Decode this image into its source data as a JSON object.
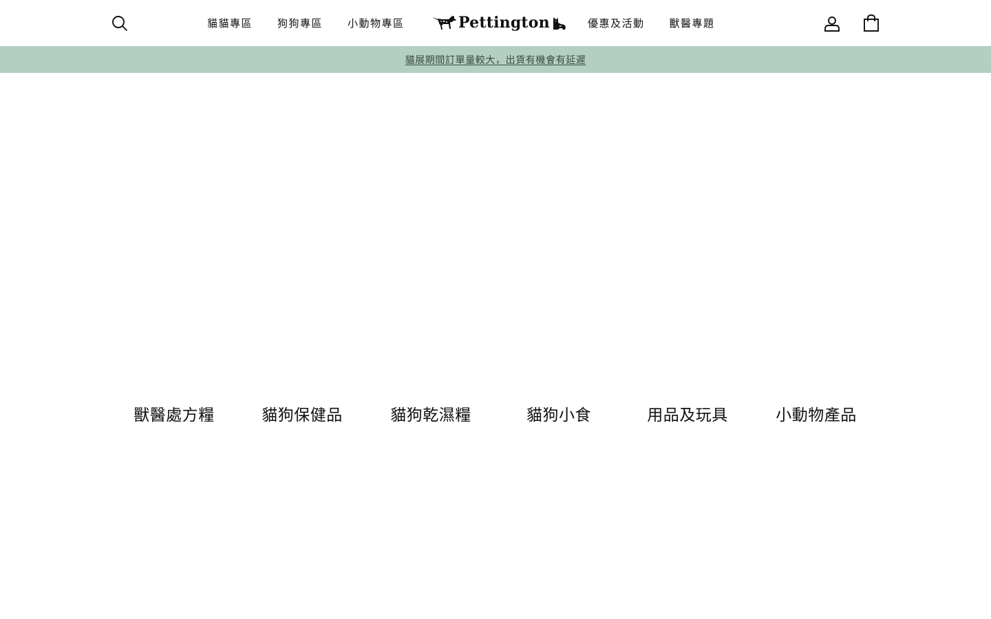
{
  "header": {
    "nav_left": [
      {
        "label": "貓貓專區"
      },
      {
        "label": "狗狗專區"
      },
      {
        "label": "小動物專區"
      }
    ],
    "logo_text": "Pettington",
    "nav_right": [
      {
        "label": "優惠及活動"
      },
      {
        "label": "獸醫專題"
      }
    ],
    "icons": {
      "search": "search-icon",
      "account": "user-icon",
      "cart": "shopping-bag-icon"
    }
  },
  "announcement": {
    "text": "貓展期間訂單量較大，出貨有機會有延遲",
    "background": "#b3cfc2",
    "text_color": "#3b4a44"
  },
  "categories": [
    {
      "label": "獸醫處方糧"
    },
    {
      "label": "貓狗保健品"
    },
    {
      "label": "貓狗乾濕糧"
    },
    {
      "label": "貓狗小食"
    },
    {
      "label": "用品及玩具"
    },
    {
      "label": "小動物產品"
    }
  ]
}
